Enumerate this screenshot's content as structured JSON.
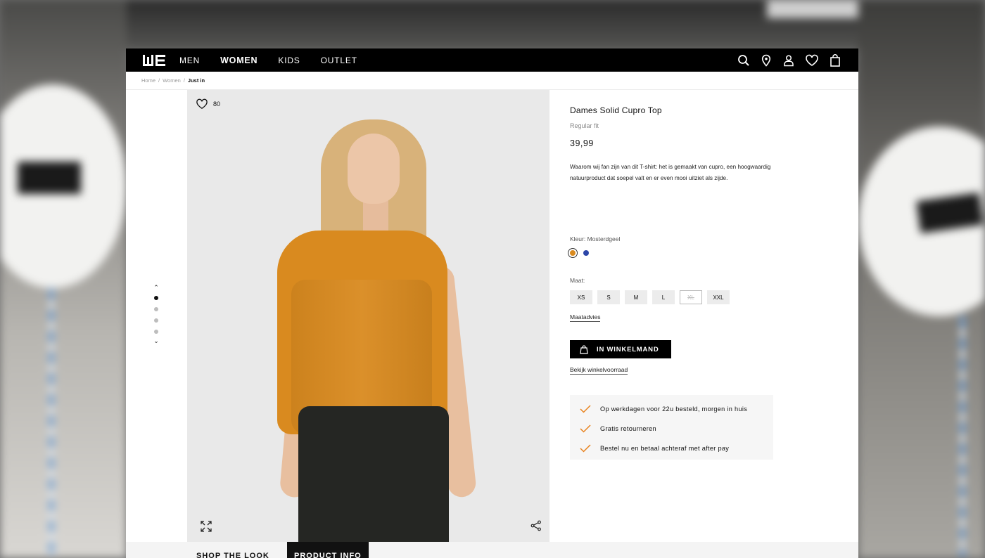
{
  "nav": {
    "logo": "WE",
    "items": [
      "MEN",
      "WOMEN",
      "KIDS",
      "OUTLET"
    ],
    "active_item": "WOMEN",
    "icons": [
      "search-icon",
      "location-icon",
      "account-icon",
      "wishlist-icon",
      "bag-icon"
    ]
  },
  "breadcrumb": {
    "items": [
      "Home",
      "Women"
    ],
    "separator": "/",
    "current": "Just in"
  },
  "gallery": {
    "favorite_count": "80",
    "slides": 4,
    "active_slide": 1
  },
  "product": {
    "title": "Dames Solid Cupro Top",
    "fit": "Regular fit",
    "price": "39,99",
    "description": "Waarom wij fan zijn van dit T-shirt: het is gemaakt van cupro, een hoogwaardig natuurproduct dat soepel valt en er even mooi uitziet als zijde.",
    "color_label": "Kleur: Mosterdgeel",
    "colors": [
      {
        "name": "Mosterdgeel",
        "hex": "#d98a1f",
        "selected": true
      },
      {
        "name": "blue",
        "hex": "#2c46a8",
        "selected": false
      }
    ],
    "size_label": "Maat:",
    "sizes": [
      {
        "label": "XS",
        "available": true
      },
      {
        "label": "S",
        "available": true
      },
      {
        "label": "M",
        "available": true
      },
      {
        "label": "L",
        "available": true
      },
      {
        "label": "XL",
        "available": false
      },
      {
        "label": "XXL",
        "available": true
      }
    ],
    "size_advice": "Maatadvies",
    "add_to_cart": "IN WINKELMAND",
    "store_stock": "Bekijk winkelvoorraad",
    "usps": [
      "Op werkdagen voor 22u besteld, morgen in huis",
      "Gratis retourneren",
      "Bestel nu en betaal achteraf met after pay"
    ]
  },
  "tabs": {
    "shop_the_look": "SHOP THE LOOK",
    "product_info": "PRODUCT INFO"
  },
  "colors": {
    "accent": "#e8821e",
    "nav_bg": "#000000"
  }
}
